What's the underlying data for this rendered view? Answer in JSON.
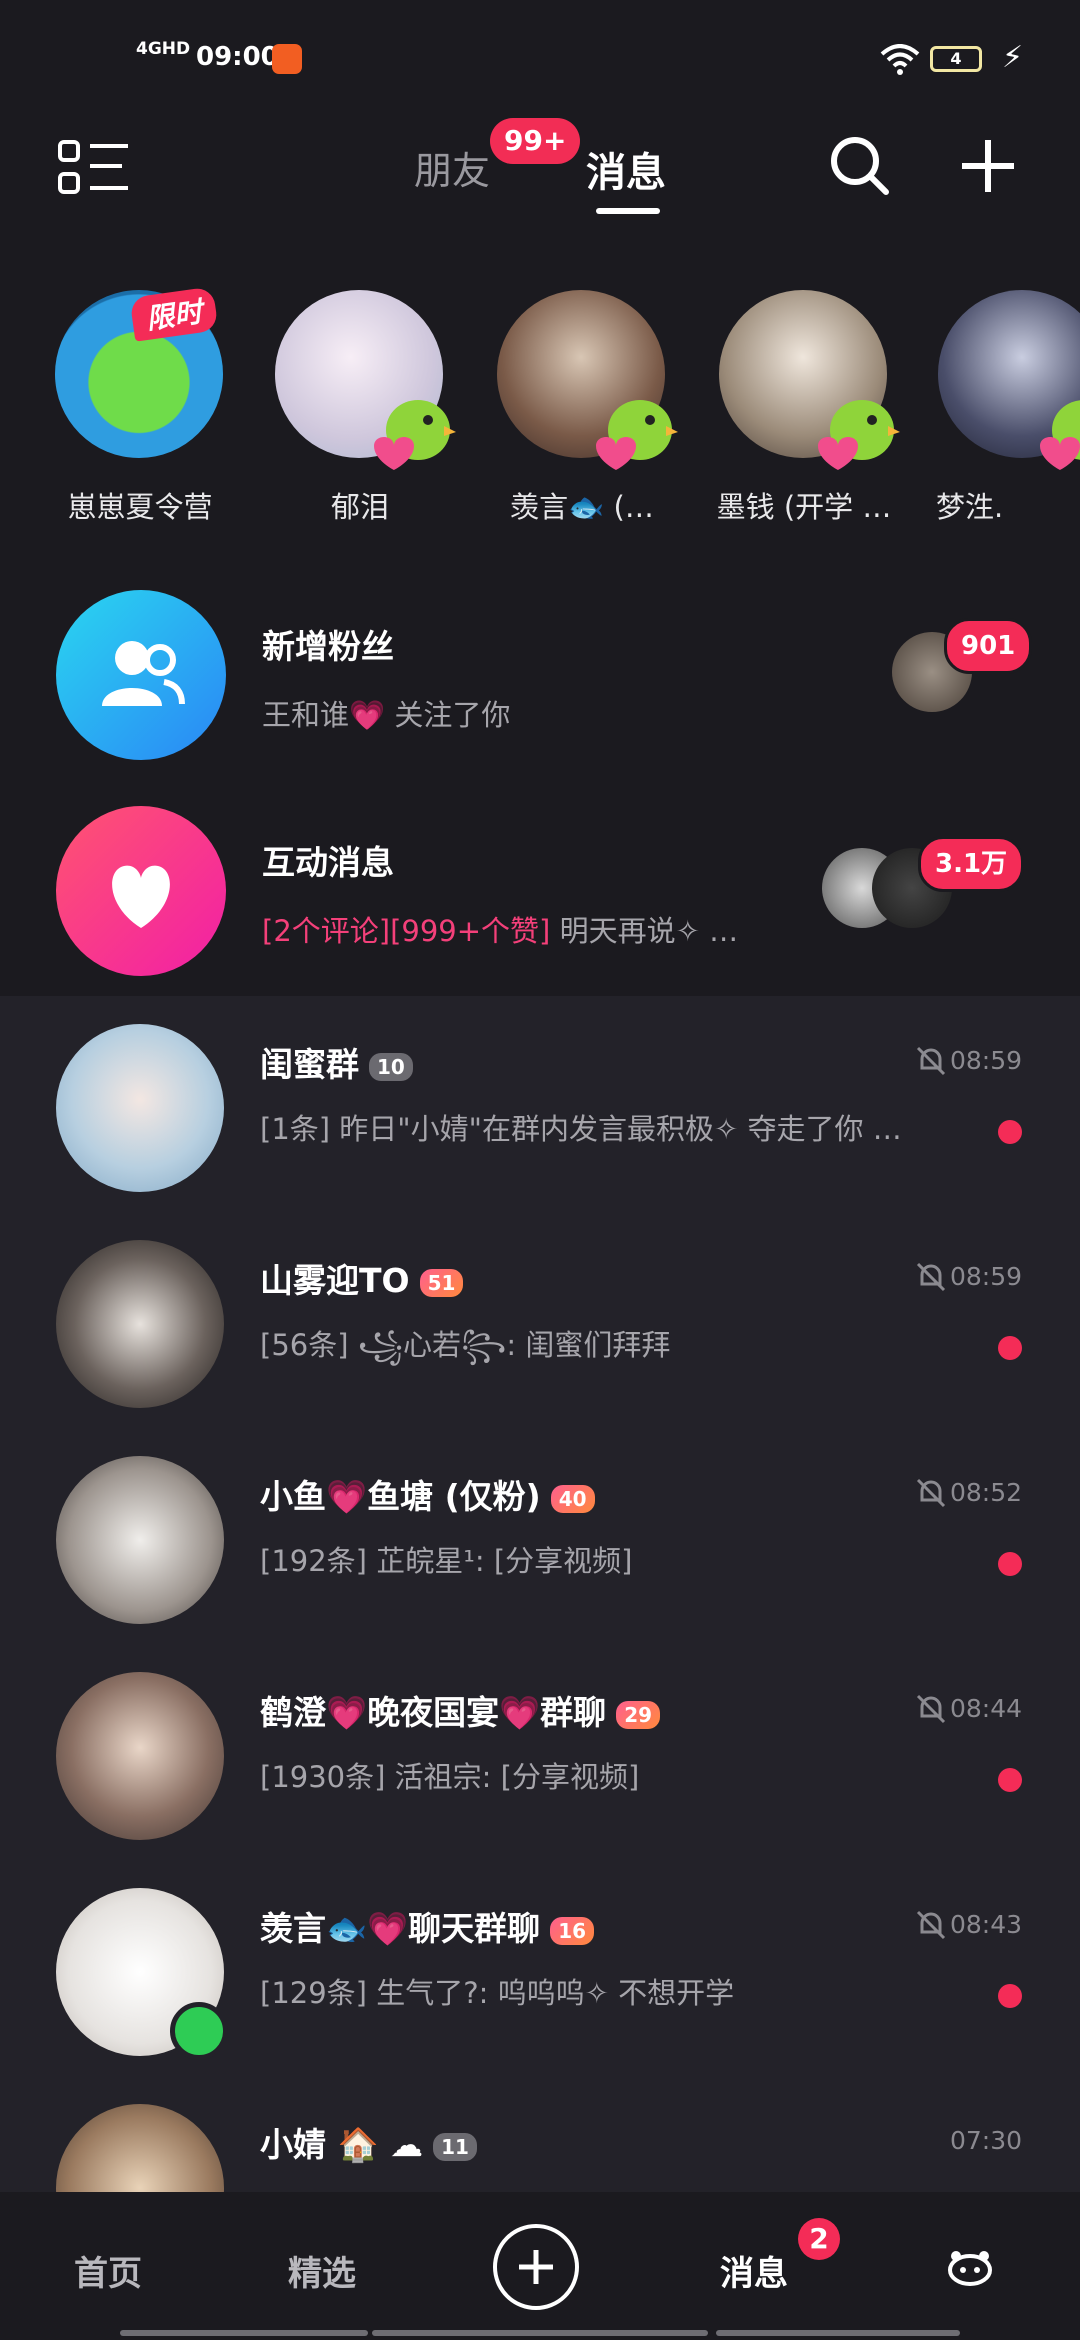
{
  "status": {
    "network": "4GHD",
    "time": "09:00",
    "battery": "4"
  },
  "header": {
    "tab_friends": "朋友",
    "tab_messages": "消息",
    "friends_badge": "99+"
  },
  "stories": [
    {
      "name": "崽崽夏令营",
      "tag": "限时"
    },
    {
      "name": "郁泪"
    },
    {
      "name": "羡言🐟 (…"
    },
    {
      "name": "墨钱 (开学 …"
    },
    {
      "name": "梦泩."
    }
  ],
  "new_fans": {
    "title": "新增粉丝",
    "subtitle": "王和谁💗 关注了你",
    "count": "901"
  },
  "interactions": {
    "title": "互动消息",
    "sub_highlight": "[2个评论][999+个赞]",
    "sub_rest": " 明天再说✧ …",
    "count": "3.1万"
  },
  "chats": [
    {
      "title": "闺蜜群",
      "fire": "10",
      "fire_grey": true,
      "time": "08:59",
      "muted": true,
      "unread_dot": true,
      "subtitle": "[1条] 昨日\"小婧\"在群内发言最积极✧ 夺走了你 …"
    },
    {
      "title": "山雾迎TO",
      "fire": "51",
      "time": "08:59",
      "muted": true,
      "unread_dot": true,
      "subtitle": "[56条] ꧁心若꧂: 闺蜜们拜拜"
    },
    {
      "title": "小鱼💗鱼塘 (仅粉)",
      "fire": "40",
      "time": "08:52",
      "muted": true,
      "unread_dot": true,
      "subtitle": "[192条] 芷皖星¹: [分享视频]"
    },
    {
      "title": "鹤澄💗晚夜国宴💗群聊",
      "fire": "29",
      "time": "08:44",
      "muted": true,
      "unread_dot": true,
      "subtitle": "[1930条] 活祖宗: [分享视频]"
    },
    {
      "title": "羡言🐟💗聊天群聊",
      "fire": "16",
      "time": "08:43",
      "muted": true,
      "unread_dot": true,
      "subtitle": "[129条] 生气了?: 呜呜呜✧ 不想开学"
    },
    {
      "title": "小婧 🏠 ☁",
      "fire": "11",
      "fire_grey": true,
      "time": "07:30",
      "muted": false,
      "unread_dot": false,
      "subtitle": ""
    }
  ],
  "bottom_nav": {
    "home": "首页",
    "featured": "精选",
    "messages": "消息",
    "messages_badge": "2"
  },
  "colors": {
    "background": "#1b1a1f",
    "list_bg": "#232229",
    "accent": "#f42c57"
  }
}
